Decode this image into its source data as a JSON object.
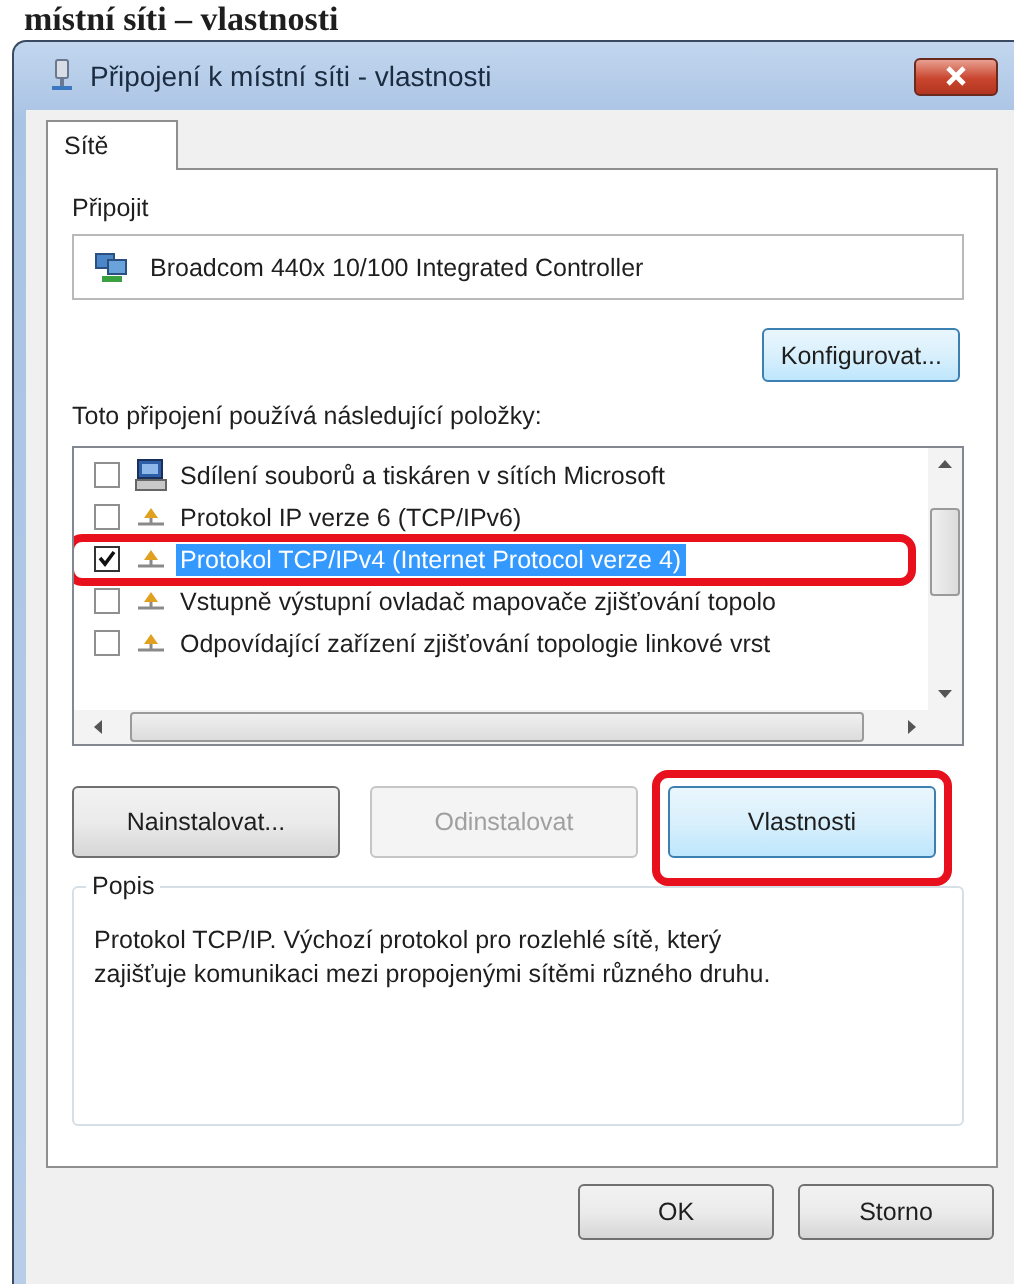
{
  "heading": "místní síti – vlastnosti",
  "window": {
    "title": "Připojení k místní síti - vlastnosti"
  },
  "tabs": [
    {
      "label": "Sítě",
      "selected": true
    }
  ],
  "connect": {
    "label": "Připojit",
    "adapter": "Broadcom 440x 10/100 Integrated Controller",
    "configure_button": "Konfigurovat..."
  },
  "items_label": "Toto připojení používá následující položky:",
  "items": [
    {
      "kind": "service",
      "label": "Sdílení souborů a tiskáren v sítích Microsoft",
      "checked": false,
      "selected": false,
      "annotated": false
    },
    {
      "kind": "protocol",
      "label": "Protokol IP verze 6 (TCP/IPv6)",
      "checked": false,
      "selected": false,
      "annotated": false
    },
    {
      "kind": "protocol",
      "label": "Protokol TCP/IPv4 (Internet Protocol verze 4)",
      "checked": true,
      "selected": true,
      "annotated": true
    },
    {
      "kind": "protocol",
      "label": "Vstupně výstupní ovladač mapovače zjišťování topolo",
      "checked": false,
      "selected": false,
      "annotated": false
    },
    {
      "kind": "protocol",
      "label": "Odpovídající zařízení zjišťování topologie linkové vrst",
      "checked": false,
      "selected": false,
      "annotated": false
    }
  ],
  "item_buttons": [
    {
      "label": "Nainstalovat...",
      "disabled": false,
      "hover": false,
      "annotated": false
    },
    {
      "label": "Odinstalovat",
      "disabled": true,
      "hover": false,
      "annotated": false
    },
    {
      "label": "Vlastnosti",
      "disabled": false,
      "hover": true,
      "annotated": true
    }
  ],
  "description": {
    "label": "Popis",
    "text": "Protokol TCP/IP. Výchozí protokol pro rozlehlé sítě, který zajišťuje komunikaci mezi propojenými sítěmi různého druhu."
  },
  "dialog_buttons": [
    "OK",
    "Storno"
  ]
}
